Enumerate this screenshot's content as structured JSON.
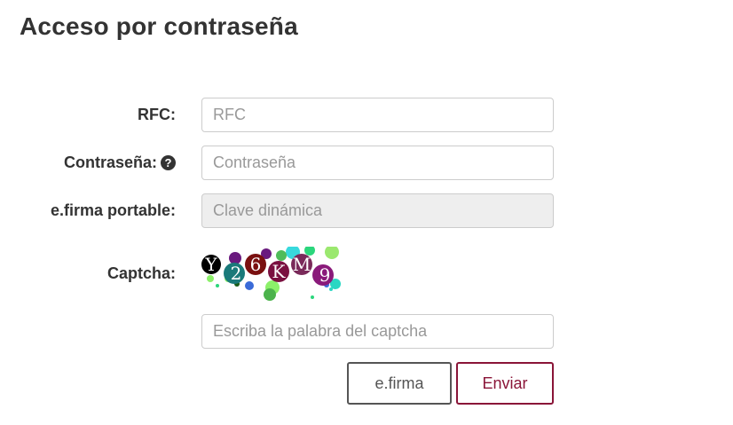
{
  "page": {
    "title": "Acceso por contraseña"
  },
  "form": {
    "rfc": {
      "label": "RFC:",
      "placeholder": "RFC"
    },
    "password": {
      "label": "Contraseña:",
      "placeholder": "Contraseña",
      "help_icon": "question-circle-icon"
    },
    "efirma_portable": {
      "label": "e.firma portable:",
      "placeholder": "Clave dinámica"
    },
    "captcha": {
      "label": "Captcha:",
      "input_placeholder": "Escriba la palabra del captcha"
    }
  },
  "buttons": {
    "efirma_label": "e.firma",
    "enviar_label": "Enviar"
  },
  "colors": {
    "text": "#333333",
    "accent": "#8a1538",
    "border": "#cccccc",
    "disabled_bg": "#eeeeee"
  }
}
